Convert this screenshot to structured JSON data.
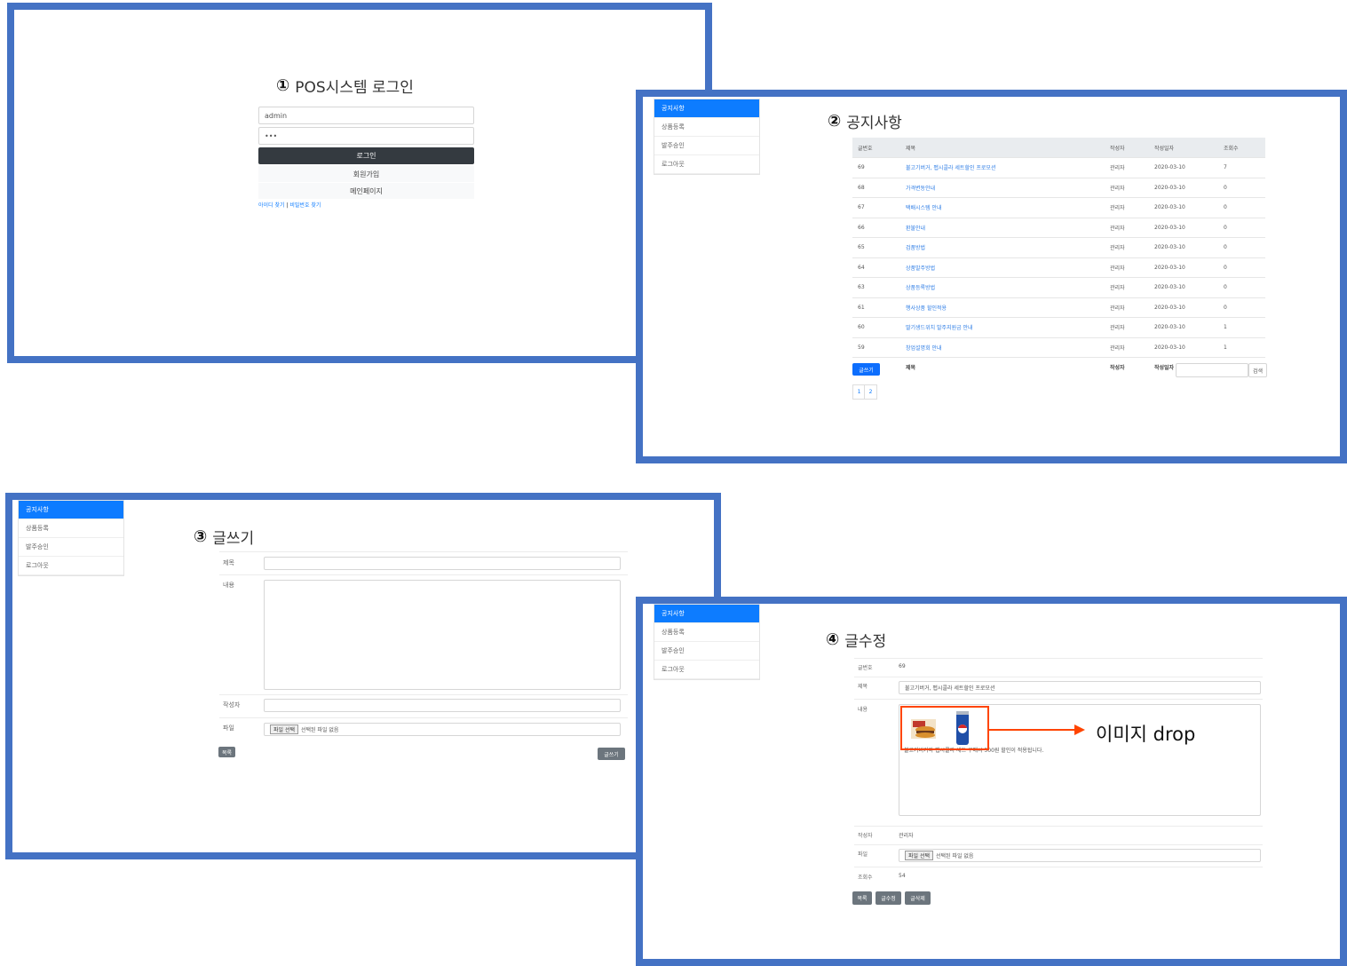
{
  "colors": {
    "frame": "#4472c4",
    "primary": "#0d7cff",
    "dark_button": "#343a40",
    "highlight": "#ff4500"
  },
  "sidebar": {
    "items": [
      "공지사항",
      "상품등록",
      "발주승인",
      "로그아웃"
    ]
  },
  "login": {
    "number": "①",
    "title": "POS시스템 로그인",
    "username_value": "admin",
    "password_value": "•••",
    "login_button": "로그인",
    "signup_button": "회원가입",
    "main_button": "메인페이지",
    "find_id": "아이디 찾기",
    "separator": "|",
    "find_password": "비밀번호 찾기"
  },
  "notice": {
    "number": "②",
    "title": "공지사항",
    "columns": [
      "글번호",
      "제목",
      "작성자",
      "작성일자",
      "조회수"
    ],
    "rows": [
      {
        "no": "69",
        "title": "불고기버거, 펩시콜라 세트할인 프로모션",
        "author": "관리자",
        "date": "2020-03-10",
        "views": "7"
      },
      {
        "no": "68",
        "title": "가격변동안내",
        "author": "관리자",
        "date": "2020-03-10",
        "views": "0"
      },
      {
        "no": "67",
        "title": "택배시스템 안내",
        "author": "관리자",
        "date": "2020-03-10",
        "views": "0"
      },
      {
        "no": "66",
        "title": "환불안내",
        "author": "관리자",
        "date": "2020-03-10",
        "views": "0"
      },
      {
        "no": "65",
        "title": "검품방법",
        "author": "관리자",
        "date": "2020-03-10",
        "views": "0"
      },
      {
        "no": "64",
        "title": "상품발주방법",
        "author": "관리자",
        "date": "2020-03-10",
        "views": "0"
      },
      {
        "no": "63",
        "title": "상품등록방법",
        "author": "관리자",
        "date": "2020-03-10",
        "views": "0"
      },
      {
        "no": "61",
        "title": "행사상품 할인적용",
        "author": "관리자",
        "date": "2020-03-10",
        "views": "0"
      },
      {
        "no": "60",
        "title": "딸기생드위치 발주지원금 안내",
        "author": "관리자",
        "date": "2020-03-10",
        "views": "1"
      },
      {
        "no": "59",
        "title": "창업설명회 안내",
        "author": "관리자",
        "date": "2020-03-10",
        "views": "1"
      }
    ],
    "write_button": "글쓰기",
    "search_button": "검색",
    "pages": [
      "1",
      "2"
    ]
  },
  "write": {
    "number": "③",
    "title": "글쓰기",
    "label_title": "제목",
    "label_content": "내용",
    "label_author": "작성자",
    "label_file": "파일",
    "file_button": "파일 선택",
    "file_status": "선택된 파일 없음",
    "list_button": "목록",
    "submit_button": "글쓰기"
  },
  "edit": {
    "number": "④",
    "title": "글수정",
    "label_no": "글번호",
    "value_no": "69",
    "label_title": "제목",
    "value_title": "불고기버거, 펩시콜라 세트할인 프로모션",
    "label_content": "내용",
    "value_content": "불고기버거와 펩시콜라 세트 구매시 500원 할인이 적용됩니다.",
    "label_author": "작성자",
    "value_author": "관리자",
    "label_file": "파일",
    "file_button": "파일 선택",
    "file_status": "선택된 파일 없음",
    "label_views": "조회수",
    "value_views": "54",
    "btn_list": "목록",
    "btn_edit": "글수정",
    "btn_delete": "글삭제",
    "annotation": "이미지 drop"
  }
}
